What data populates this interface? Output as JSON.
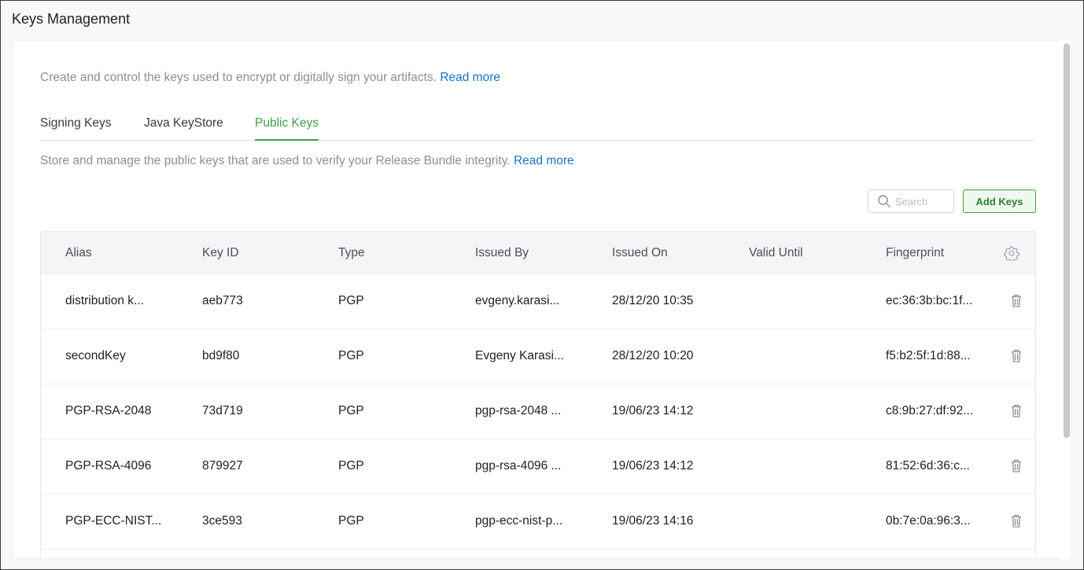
{
  "page": {
    "title": "Keys Management"
  },
  "intro": {
    "text": "Create and control the keys used to encrypt or digitally sign your artifacts.",
    "link": "Read more"
  },
  "tabs": [
    {
      "label": "Signing Keys",
      "active": false
    },
    {
      "label": "Java KeyStore",
      "active": false
    },
    {
      "label": "Public Keys",
      "active": true
    }
  ],
  "public_keys": {
    "description": "Store and manage the public keys that are used to verify your Release Bundle integrity.",
    "link": "Read more"
  },
  "toolbar": {
    "search_placeholder": "Search",
    "add_label": "Add Keys"
  },
  "table": {
    "columns": [
      "Alias",
      "Key ID",
      "Type",
      "Issued By",
      "Issued On",
      "Valid Until",
      "Fingerprint"
    ],
    "rows": [
      {
        "alias": "distribution k...",
        "key_id": "aeb773",
        "type": "PGP",
        "issued_by": "evgeny.karasi...",
        "issued_on": "28/12/20 10:35",
        "valid_until": "",
        "fingerprint": "ec:36:3b:bc:1f..."
      },
      {
        "alias": "secondKey",
        "key_id": "bd9f80",
        "type": "PGP",
        "issued_by": "Evgeny Karasi...",
        "issued_on": "28/12/20 10:20",
        "valid_until": "",
        "fingerprint": "f5:b2:5f:1d:88..."
      },
      {
        "alias": "PGP-RSA-2048",
        "key_id": "73d719",
        "type": "PGP",
        "issued_by": "pgp-rsa-2048 ...",
        "issued_on": "19/06/23 14:12",
        "valid_until": "",
        "fingerprint": "c8:9b:27:df:92..."
      },
      {
        "alias": "PGP-RSA-4096",
        "key_id": "879927",
        "type": "PGP",
        "issued_by": "pgp-rsa-4096 ...",
        "issued_on": "19/06/23 14:12",
        "valid_until": "",
        "fingerprint": "81:52:6d:36:c..."
      },
      {
        "alias": "PGP-ECC-NIST...",
        "key_id": "3ce593",
        "type": "PGP",
        "issued_by": "pgp-ecc-nist-p...",
        "issued_on": "19/06/23 14:16",
        "valid_until": "",
        "fingerprint": "0b:7e:0a:96:3..."
      }
    ]
  },
  "colors": {
    "accent": "#43a047",
    "link": "#1a73c8",
    "muted_text": "#8a8f98"
  },
  "icons": {
    "search": "search-icon",
    "settings": "gear-icon",
    "delete": "trash-icon"
  }
}
